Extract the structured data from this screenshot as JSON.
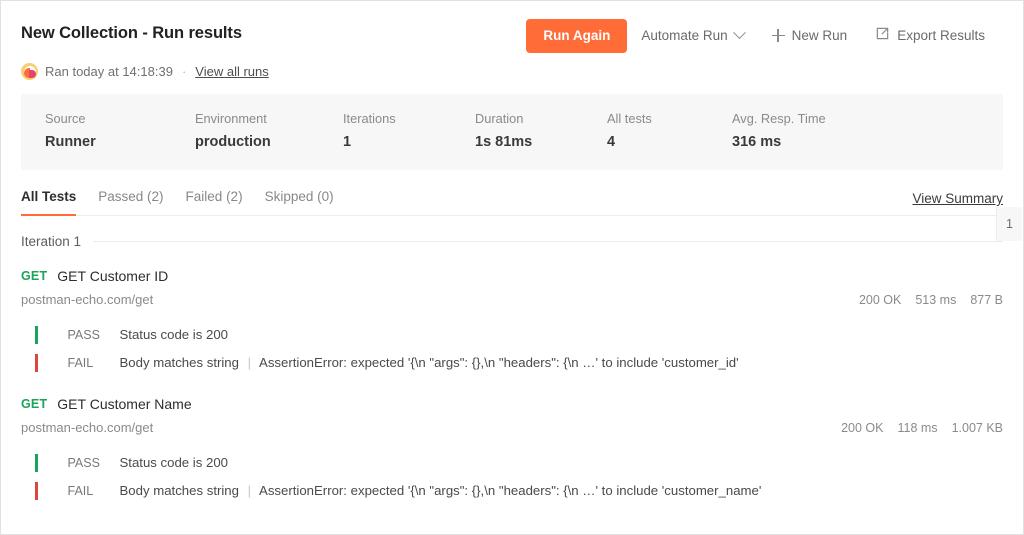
{
  "header": {
    "title": "New Collection - Run results",
    "ran_text": "Ran today at 14:18:39",
    "separator": "·",
    "view_all_runs": "View all runs",
    "avatar_icon": "postman-logo-icon"
  },
  "actions": {
    "run_again": "Run Again",
    "automate_run": "Automate Run",
    "new_run": "New Run",
    "export_results": "Export Results",
    "chevron_icon": "chevron-down-icon",
    "plus_icon": "plus-icon",
    "export_icon": "share-export-icon",
    "accent_color": "#ff6c37"
  },
  "stats": [
    {
      "label": "Source",
      "value": "Runner"
    },
    {
      "label": "Environment",
      "value": "production"
    },
    {
      "label": "Iterations",
      "value": "1"
    },
    {
      "label": "Duration",
      "value": "1s 81ms"
    },
    {
      "label": "All tests",
      "value": "4"
    },
    {
      "label": "Avg. Resp. Time",
      "value": "316 ms"
    }
  ],
  "tabs": [
    {
      "label": "All Tests",
      "active": true
    },
    {
      "label": "Passed (2)",
      "active": false
    },
    {
      "label": "Failed (2)",
      "active": false
    },
    {
      "label": "Skipped (0)",
      "active": false
    }
  ],
  "view_summary": "View Summary",
  "iteration": {
    "label": "Iteration 1",
    "badge": "1"
  },
  "tests": [
    {
      "method": "GET",
      "name": "GET Customer ID",
      "url": "postman-echo.com/get",
      "status": "200 OK",
      "time": "513 ms",
      "size": "877 B",
      "assertions": [
        {
          "result": "PASS",
          "name": "Status code is 200",
          "error": ""
        },
        {
          "result": "FAIL",
          "name": "Body matches string",
          "error": "AssertionError: expected '{\\n \"args\": {},\\n \"headers\": {\\n …' to include 'customer_id'"
        }
      ]
    },
    {
      "method": "GET",
      "name": "GET Customer Name",
      "url": "postman-echo.com/get",
      "status": "200 OK",
      "time": "118 ms",
      "size": "1.007 KB",
      "assertions": [
        {
          "result": "PASS",
          "name": "Status code is 200",
          "error": ""
        },
        {
          "result": "FAIL",
          "name": "Body matches string",
          "error": "AssertionError: expected '{\\n \"args\": {},\\n \"headers\": {\\n …' to include 'customer_name'"
        }
      ]
    }
  ],
  "colors": {
    "pass": "#1aa35b",
    "fail": "#e0443e",
    "accent": "#ff6c37"
  }
}
